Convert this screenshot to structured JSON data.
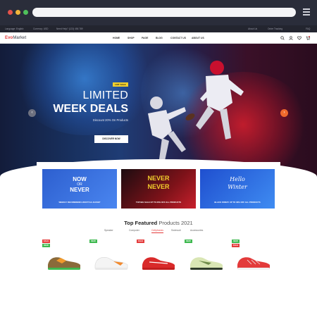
{
  "browser": {
    "menu_icon": "hamburger-menu-icon"
  },
  "top_bar": {
    "language": "Language: English",
    "currency": "Currency: USD",
    "help": "Need Help? (123) 456 789",
    "my_account": "About Us",
    "order_tracking": "Order Tracking",
    "faq": "FAQ"
  },
  "header": {
    "logo_brand": "Evo",
    "logo_rest": "Market",
    "nav": [
      "HOME",
      "SHOP",
      "PAGE",
      "BLOG",
      "CONTACT US",
      "ABOUT US"
    ],
    "icons": [
      "search-icon",
      "user-icon",
      "heart-icon",
      "cart-icon"
    ],
    "cart_count": "0"
  },
  "hero": {
    "badge": "HOT SALE",
    "title_line1": "LIMITED",
    "title_line2": "WEEK DEALS",
    "subtitle": "Discount 20% On Products",
    "button": "DISCOVER NOW",
    "prev_arrow": "‹",
    "next_arrow": "›"
  },
  "promos": [
    {
      "line1": "NOW",
      "line2": "OR",
      "line3": "NEVER",
      "caption": "WEEKLY RECOMMEND LIFESTYLE JACKET",
      "color": "#3a6fd8"
    },
    {
      "line1": "NEVER",
      "line2": "NEVER",
      "line3": "",
      "caption": "TOP BIG SALE UP TO 30% OFF ALL PRODUCTS",
      "color": "#c8202c"
    },
    {
      "line1": "Hello",
      "line2": "Winter",
      "line3": "",
      "caption": "BLACK FRIDAY UP TO 30% OFF ALL PRODUCTS",
      "color": "#2f6fe0"
    }
  ],
  "featured": {
    "title_bold": "Top Featured",
    "title_light": "Products 2021",
    "tabs": [
      "Speaker",
      "Computer",
      "Cellphones",
      "Swimsuit",
      "Accessories"
    ],
    "active_tab": "Cellphones"
  },
  "products": [
    {
      "badges": [
        {
          "text": "SALE",
          "type": "sale"
        },
        {
          "text": "NEW",
          "type": "new"
        }
      ],
      "colors": [
        "#8a6a3a",
        "#f19a2b",
        "#3fb950"
      ]
    },
    {
      "badges": [
        {
          "text": "NEW",
          "type": "new"
        }
      ],
      "colors": [
        "#f4f4f4",
        "#e8e8e8",
        "#f28a2f"
      ]
    },
    {
      "badges": [
        {
          "text": "SALE",
          "type": "sale"
        }
      ],
      "colors": [
        "#d92a2a",
        "#c21e1e",
        "#ffffff"
      ]
    },
    {
      "badges": [
        {
          "text": "NEW",
          "type": "new"
        }
      ],
      "colors": [
        "#d9e6b4",
        "#6f8c4a",
        "#2f3b2a"
      ]
    },
    {
      "badges": [
        {
          "text": "NEW",
          "type": "new"
        },
        {
          "text": "SALE",
          "type": "sale"
        }
      ],
      "colors": [
        "#e33a3a",
        "#c82828",
        "#f1f1f1"
      ]
    }
  ],
  "colors": {
    "accent": "#e43b3b",
    "hot_badge": "#f2cf2c",
    "next_arrow": "#ef6a2c",
    "new_badge": "#3fb950"
  }
}
